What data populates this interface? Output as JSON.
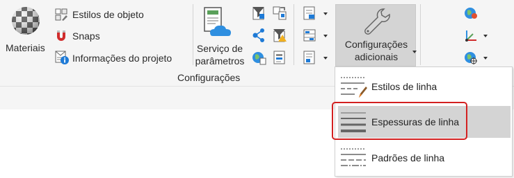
{
  "ribbon": {
    "materiais": {
      "label": "Materiais",
      "icon": "checker-sphere-icon"
    },
    "small_items": [
      {
        "label": "Estilos de  objeto",
        "icon": "object-styles-icon"
      },
      {
        "label": "Snaps",
        "icon": "snaps-magnet-icon"
      },
      {
        "label": "Informações do  projeto",
        "icon": "project-info-icon"
      }
    ],
    "servico": {
      "label_line1": "Serviço de",
      "label_line2": "parâmetros",
      "icon": "parameter-service-icon"
    },
    "config_adicionais": {
      "label_line1": "Configurações",
      "label_line2": "adicionais",
      "icon": "wrench-icon"
    },
    "panel_title": "Configurações"
  },
  "dropdown": {
    "items": [
      {
        "label": "Estilos de linha",
        "icon": "line-styles-icon",
        "highlighted": false
      },
      {
        "label": "Espessuras de linha",
        "icon": "line-weights-icon",
        "highlighted": true
      },
      {
        "label": "Padrões de linha",
        "icon": "line-patterns-icon",
        "highlighted": false
      }
    ]
  },
  "colors": {
    "accent_blue": "#1e7ad6",
    "cloud_blue": "#2f8fe0",
    "highlight": "#d4d4d4",
    "red_box": "#d32020",
    "snaps_red": "#d02c2c"
  }
}
